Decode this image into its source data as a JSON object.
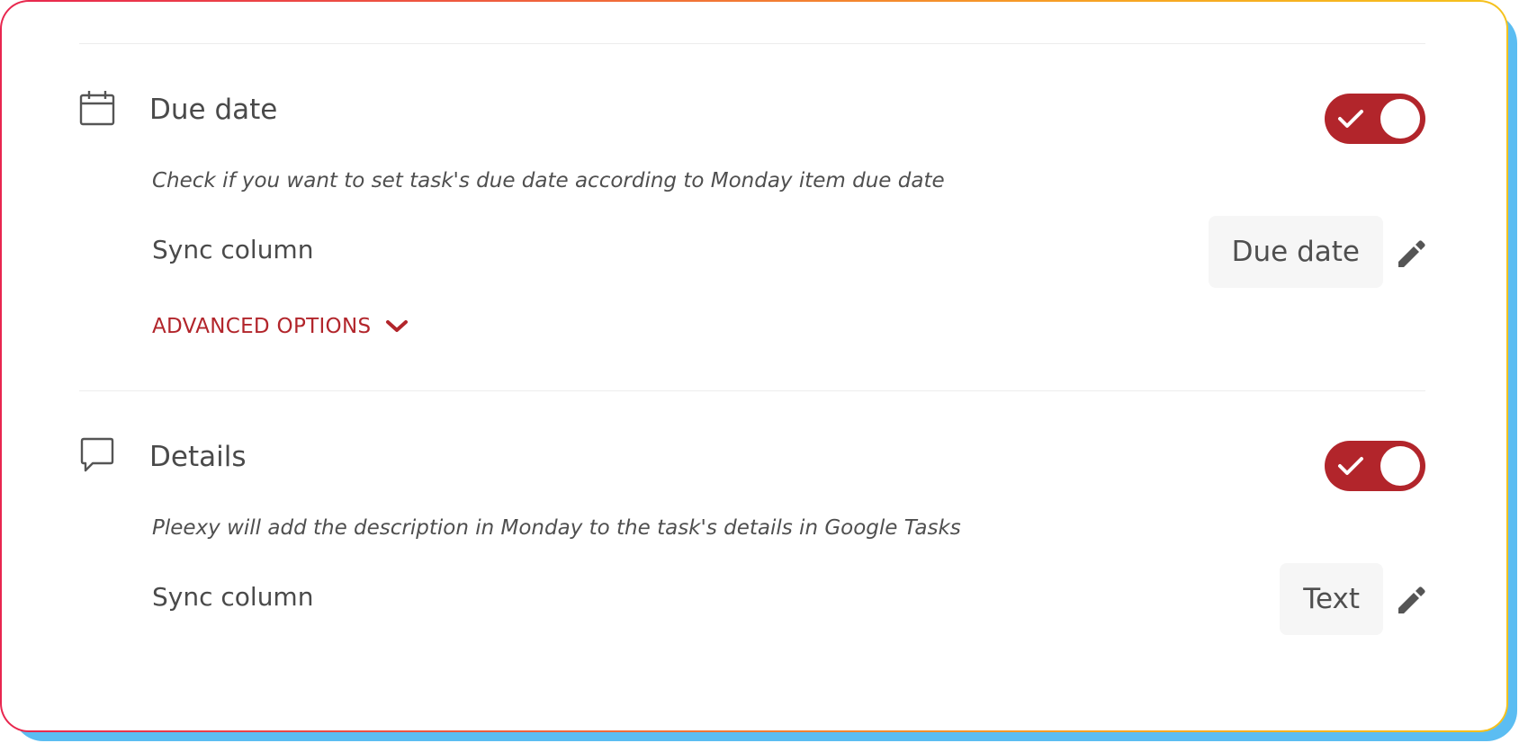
{
  "sections": [
    {
      "title": "Due date",
      "icon": "calendar-icon",
      "enabled": true,
      "description": "Check if you want to set task's due date according to Monday item due date",
      "sync_label": "Sync column",
      "sync_value": "Due date",
      "advanced_label": "ADVANCED OPTIONS"
    },
    {
      "title": "Details",
      "icon": "speech-bubble-icon",
      "enabled": true,
      "description": "Pleexy will add the description in Monday to the task's details in Google Tasks",
      "sync_label": "Sync column",
      "sync_value": "Text"
    }
  ],
  "colors": {
    "accent": "#b2252b",
    "text": "#4a4a4a",
    "value_bg": "#f6f6f6",
    "frame_shadow": "#5bbdf2"
  }
}
